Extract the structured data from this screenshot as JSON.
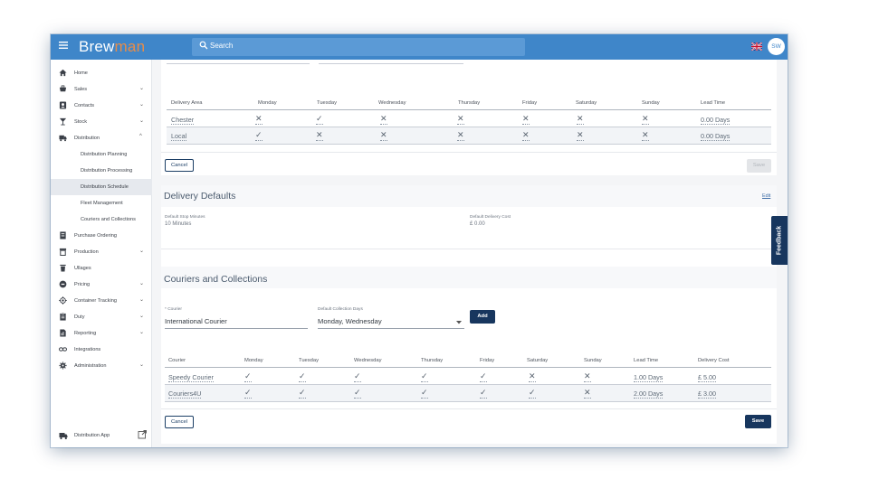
{
  "topbar": {
    "logo_part1": "Brew",
    "logo_part2": "man",
    "search_placeholder": "Search",
    "avatar_initials": "SW"
  },
  "sidebar": {
    "items": [
      {
        "label": "Home",
        "icon": "home-icon",
        "chevron": ""
      },
      {
        "label": "Sales",
        "icon": "cart-icon",
        "chevron": "⌄"
      },
      {
        "label": "Contacts",
        "icon": "contacts-icon",
        "chevron": "⌄"
      },
      {
        "label": "Stock",
        "icon": "glass-icon",
        "chevron": "⌄"
      },
      {
        "label": "Distribution",
        "icon": "truck-icon",
        "chevron": "^"
      }
    ],
    "sub_items": [
      {
        "label": "Distribution Planning"
      },
      {
        "label": "Distribution Processing"
      },
      {
        "label": "Distribution Schedule"
      },
      {
        "label": "Fleet Management"
      },
      {
        "label": "Couriers and Collections"
      }
    ],
    "items2": [
      {
        "label": "Purchase Ordering",
        "icon": "receipt-icon",
        "chevron": ""
      },
      {
        "label": "Production",
        "icon": "production-icon",
        "chevron": "⌄"
      },
      {
        "label": "Ullages",
        "icon": "bin-icon",
        "chevron": ""
      },
      {
        "label": "Pricing",
        "icon": "pricing-icon",
        "chevron": "⌄"
      },
      {
        "label": "Container Tracking",
        "icon": "tracking-icon",
        "chevron": "⌄"
      },
      {
        "label": "Duty",
        "icon": "duty-icon",
        "chevron": "⌄"
      },
      {
        "label": "Reporting",
        "icon": "report-icon",
        "chevron": "⌄"
      },
      {
        "label": "Integrations",
        "icon": "link-icon",
        "chevron": ""
      },
      {
        "label": "Administration",
        "icon": "gear-icon",
        "chevron": "⌄"
      }
    ],
    "distribution_app": "Distribution App"
  },
  "delivery_areas": {
    "headers": [
      "Delivery Area",
      "Monday",
      "Tuesday",
      "Wednesday",
      "Thursday",
      "Friday",
      "Saturday",
      "Sunday",
      "Lead Time"
    ],
    "rows": [
      {
        "area": "Chester",
        "days": [
          "✕",
          "✓",
          "✕",
          "✕",
          "✕",
          "✕",
          "✕"
        ],
        "lead_time": "0.00 Days"
      },
      {
        "area": "Local",
        "days": [
          "✓",
          "✕",
          "✕",
          "✕",
          "✕",
          "✕",
          "✕"
        ],
        "lead_time": "0.00 Days"
      }
    ],
    "cancel_label": "Cancel",
    "save_label": "Save"
  },
  "delivery_defaults": {
    "title": "Delivery Defaults",
    "edit_label": "Edit",
    "stop_minutes_label": "Default Stop Minutes",
    "stop_minutes_value": "10 Minutes",
    "cost_label": "Default Delivery Cost",
    "cost_value": "£ 0.00"
  },
  "couriers": {
    "title": "Couriers and Collections",
    "courier_label": "* Courier",
    "courier_value": "International Courier",
    "days_label": "Default Collection Days",
    "days_value": "Monday, Wednesday",
    "add_label": "Add",
    "headers": [
      "Courier",
      "Monday",
      "Tuesday",
      "Wednesday",
      "Thursday",
      "Friday",
      "Saturday",
      "Sunday",
      "Lead Time",
      "Delivery Cost"
    ],
    "rows": [
      {
        "name": "Speedy Courier",
        "days": [
          "✓",
          "✓",
          "✓",
          "✓",
          "✓",
          "✕",
          "✕"
        ],
        "lead_time": "1.00 Days",
        "cost": "£ 5.00"
      },
      {
        "name": "Couriers4U",
        "days": [
          "✓",
          "✓",
          "✓",
          "✓",
          "✓",
          "✓",
          "✕"
        ],
        "lead_time": "2.00 Days",
        "cost": "£ 3.00"
      }
    ],
    "cancel_label": "Cancel",
    "save_label": "Save"
  },
  "feedback_label": "Feedback"
}
